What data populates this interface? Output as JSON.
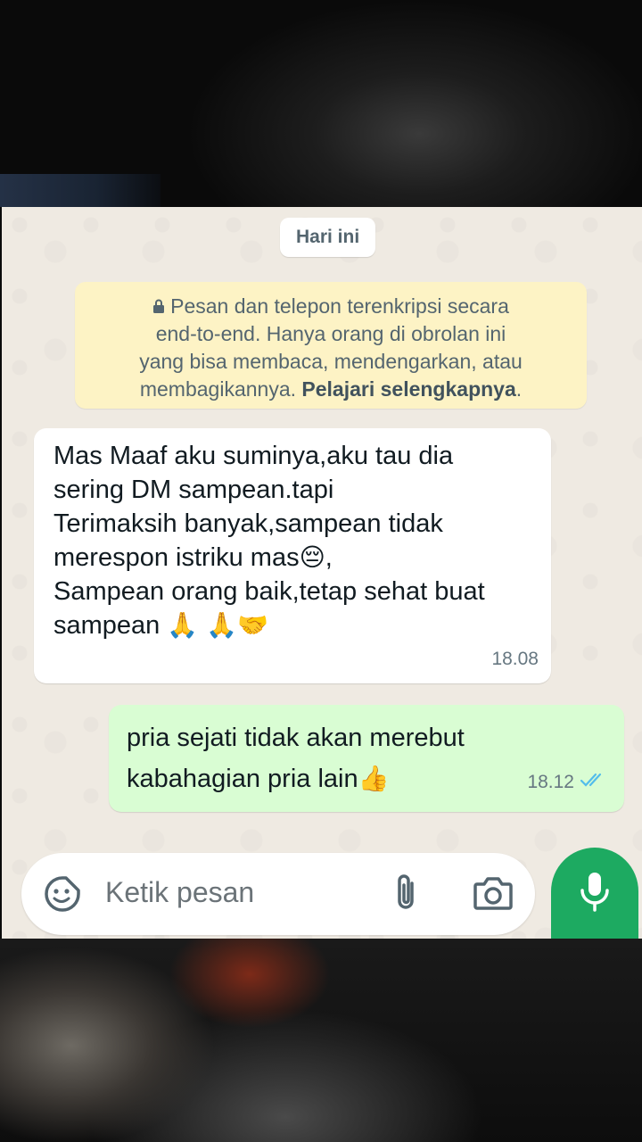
{
  "chat": {
    "date_chip": "Hari ini",
    "encryption_notice": {
      "lines": [
        "Pesan dan telepon terenkripsi secara",
        "end-to-end. Hanya orang di obrolan ini",
        "yang bisa membaca, mendengarkan, atau",
        "membagikannya."
      ],
      "link": "Pelajari selengkapnya",
      "trailing": "."
    },
    "messages": [
      {
        "direction": "incoming",
        "lines": [
          "Mas Maaf aku suminya,aku tau dia",
          "sering DM sampean.tapi",
          "Terimaksih banyak,sampean tidak",
          "merespon istriku mas",
          "Sampean orang baik,tetap sehat buat",
          "sampean"
        ],
        "emoji_pensive": "😔",
        "comma": ",",
        "emoji_end": "🙏 🙏🤝",
        "time": "18.08"
      },
      {
        "direction": "outgoing",
        "lines": [
          "pria sejati tidak akan merebut",
          "kabahagian pria lain"
        ],
        "emoji_end": "👍",
        "time": "18.12",
        "status": "read"
      }
    ]
  },
  "composer": {
    "placeholder": "Ketik pesan",
    "icons": [
      "sticker-icon",
      "attach-icon",
      "camera-icon",
      "mic-icon"
    ]
  },
  "colors": {
    "chat_background": "#efeae2",
    "incoming_bubble": "#ffffff",
    "outgoing_bubble": "#d9fdd3",
    "notice_background": "#fdf3c5",
    "accent_green": "#1daa61",
    "read_ticks": "#53bdeb"
  }
}
